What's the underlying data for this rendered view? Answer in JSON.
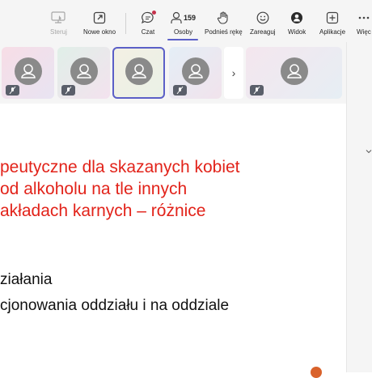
{
  "toolbar": {
    "items": [
      {
        "label": "Steruj",
        "icon": "share-screen-icon",
        "disabled": true
      },
      {
        "label": "Nowe okno",
        "icon": "new-window-icon"
      },
      {
        "label": "Czat",
        "icon": "chat-icon"
      },
      {
        "label": "Osoby",
        "icon": "people-icon",
        "count": "159"
      },
      {
        "label": "Podnieś rękę",
        "icon": "raise-hand-icon"
      },
      {
        "label": "Zareaguj",
        "icon": "react-icon"
      },
      {
        "label": "Widok",
        "icon": "view-icon"
      },
      {
        "label": "Aplikacje",
        "icon": "apps-icon"
      },
      {
        "label": "Więc",
        "icon": "more-icon"
      }
    ]
  },
  "strip": {
    "next_label": "›"
  },
  "slide": {
    "title_lines": [
      "peutyczne dla skazanych kobiet",
      "od alkoholu na tle innych",
      "akładach karnych – różnice"
    ],
    "bullets": [
      "ziałania",
      "cjonowania oddziału i na oddziale"
    ]
  },
  "colors": {
    "accent": "#5b5fc7",
    "title_red": "#e2231a",
    "avatar_gray": "#8a8a8a"
  }
}
